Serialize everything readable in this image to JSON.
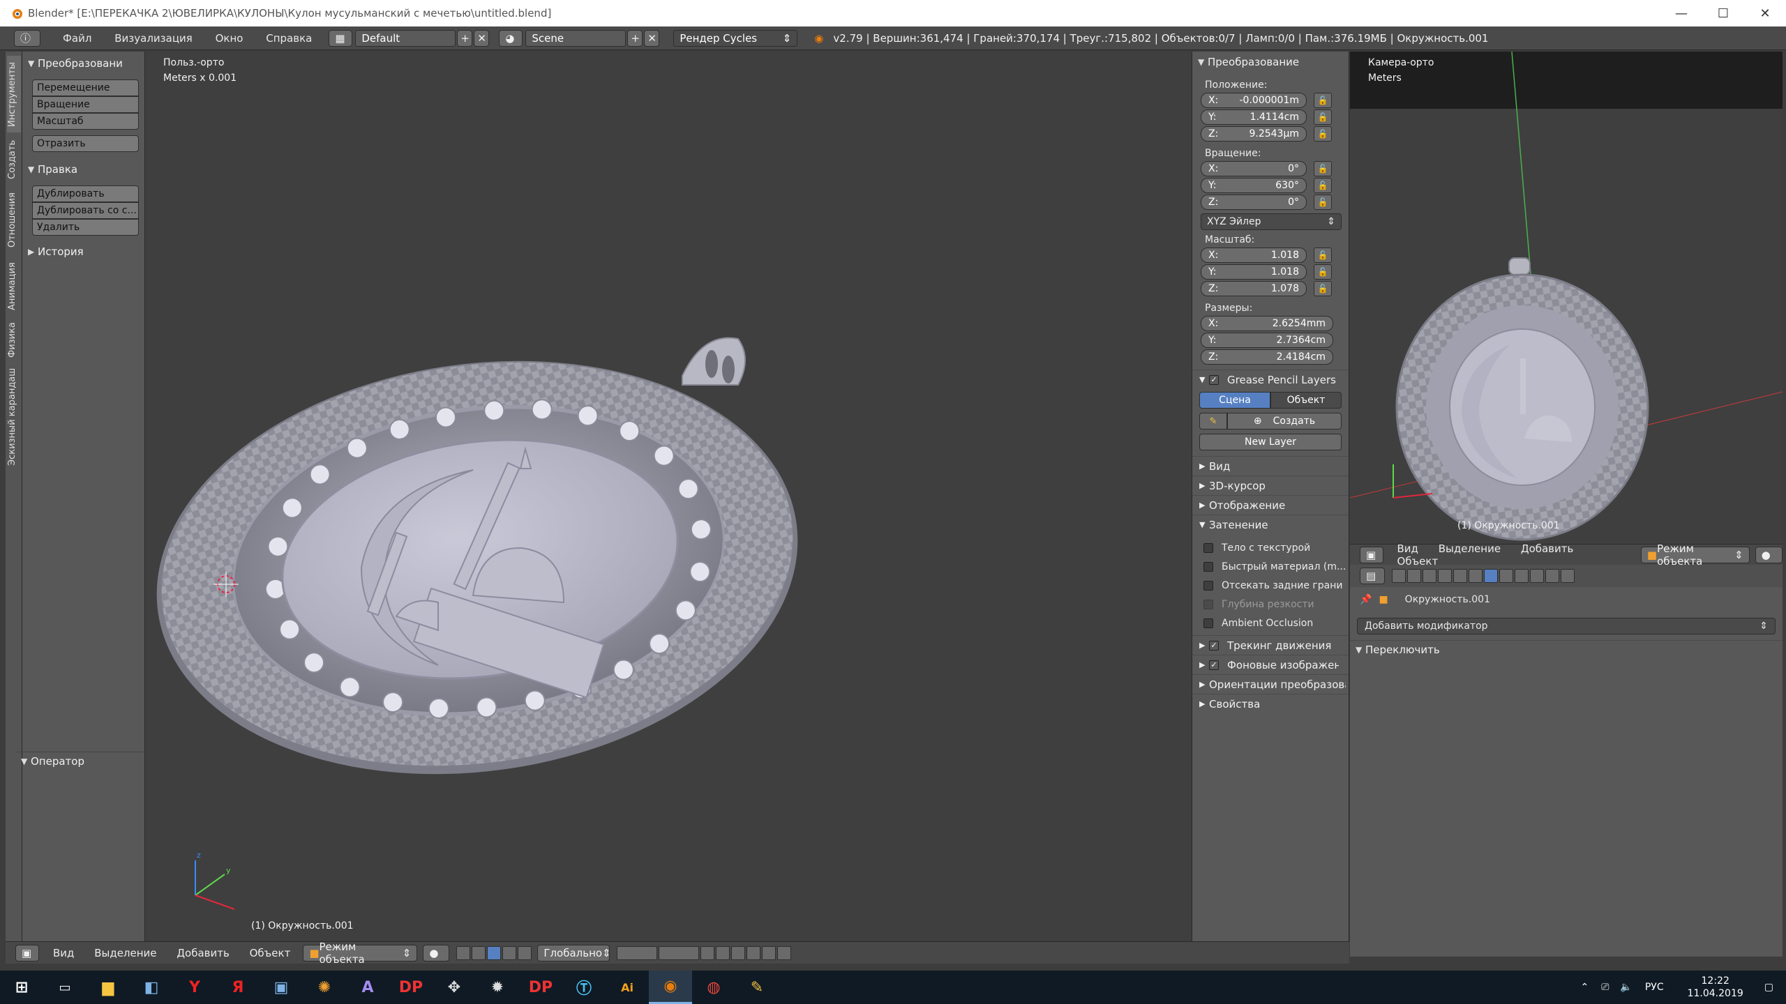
{
  "window": {
    "title": "Blender* [E:\\ПЕРЕКАЧКА 2\\ЮВЕЛИРКА\\КУЛОНЫ\\Кулон мусульманский с мечетью\\untitled.blend]",
    "minimize": "—",
    "maximize": "☐",
    "close": "✕"
  },
  "topbar": {
    "menus": [
      "Файл",
      "Визуализация",
      "Окно",
      "Справка"
    ],
    "layout_name": "Default",
    "scene_name": "Scene",
    "render_engine": "Рендер Cycles",
    "stats": "v2.79 | Вершин:361,474 | Граней:370,174 | Треуг.:715,802 | Объектов:0/7 | Ламп:0/0 | Пам.:376.19МБ | Окружность.001"
  },
  "left_tabs": [
    "Инструменты",
    "Создать",
    "Отношения",
    "Анимация",
    "Физика",
    "Эскизный карандаш"
  ],
  "toolshelf": {
    "transform_title": "Преобразовани",
    "transform_buttons": [
      "Перемещение",
      "Вращение",
      "Масштаб"
    ],
    "mirror_button": "Отразить",
    "edit_title": "Правка",
    "edit_buttons": [
      "Дублировать",
      "Дублировать со с...",
      "Удалить"
    ],
    "history_title": "История",
    "operator_title": "Оператор"
  },
  "viewport": {
    "view_name": "Польз.-орто",
    "units": "Meters x 0.001",
    "object_name": "(1) Окружность.001"
  },
  "npanel": {
    "transform_title": "Преобразование",
    "location_label": "Положение:",
    "location": [
      {
        "axis": "X:",
        "value": "-0.000001m"
      },
      {
        "axis": "Y:",
        "value": "1.4114cm"
      },
      {
        "axis": "Z:",
        "value": "9.2543μm"
      }
    ],
    "rotation_label": "Вращение:",
    "rotation": [
      {
        "axis": "X:",
        "value": "0°"
      },
      {
        "axis": "Y:",
        "value": "630°"
      },
      {
        "axis": "Z:",
        "value": "0°"
      }
    ],
    "rotation_mode": "XYZ Эйлер",
    "scale_label": "Масштаб:",
    "scale": [
      {
        "axis": "X:",
        "value": "1.018"
      },
      {
        "axis": "Y:",
        "value": "1.018"
      },
      {
        "axis": "Z:",
        "value": "1.078"
      }
    ],
    "dimensions_label": "Размеры:",
    "dimensions": [
      {
        "axis": "X:",
        "value": "2.6254mm"
      },
      {
        "axis": "Y:",
        "value": "2.7364cm"
      },
      {
        "axis": "Z:",
        "value": "2.4184cm"
      }
    ],
    "grease_pencil_title": "Grease Pencil Layers",
    "gp_scene_tab": "Сцена",
    "gp_object_tab": "Объект",
    "gp_create": "Создать",
    "gp_new_layer": "New Layer",
    "view": "Вид",
    "cursor3d": "3D-курсор",
    "display": "Отображение",
    "shading_title": "Затенение",
    "shading_options": [
      "Тело с текстурой",
      "Быстрый материал (m...",
      "Отсекать задние грани",
      "Глубина резкости",
      "Ambient Occlusion"
    ],
    "motion_tracking": "Трекинг движения",
    "background_images": "Фоновые изображения",
    "transform_orientations": "Ориентации преобразования",
    "properties": "Свойства"
  },
  "camview": {
    "view_name": "Камера-орто",
    "units": "Meters",
    "object_name": "(1) Окружность.001"
  },
  "properties_editor": {
    "menus": [
      "Вид",
      "Выделение",
      "Добавить",
      "Объект"
    ],
    "mode": "Режим объекта",
    "object_path": "Окружность.001",
    "add_modifier": "Добавить модификатор",
    "switch_panel": "Переключить"
  },
  "bottombar": {
    "menus": [
      "Вид",
      "Выделение",
      "Добавить",
      "Объект"
    ],
    "mode": "Режим объекта",
    "orientation": "Глобально"
  },
  "taskbar": {
    "language": "РУС",
    "time": "12:22",
    "date": "11.04.2019"
  }
}
